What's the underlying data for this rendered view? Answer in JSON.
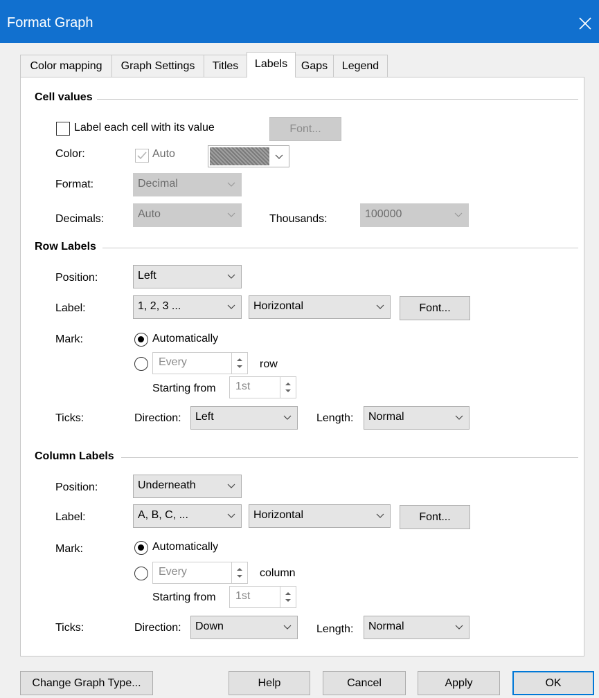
{
  "window": {
    "title": "Format Graph"
  },
  "tabs": [
    "Color mapping",
    "Graph Settings",
    "Titles",
    "Labels",
    "Gaps",
    "Legend"
  ],
  "cell_values": {
    "section_title": "Cell values",
    "label_each_cell": "Label each cell with its value",
    "font_button": "Font...",
    "color_label": "Color:",
    "auto_label": "Auto",
    "format_label": "Format:",
    "format_value": "Decimal",
    "decimals_label": "Decimals:",
    "decimals_value": "Auto",
    "thousands_label": "Thousands:",
    "thousands_value": "100000"
  },
  "row_labels": {
    "section_title": "Row Labels",
    "position_label": "Position:",
    "position_value": "Left",
    "label_label": "Label:",
    "label_value": "1, 2, 3 ...",
    "orientation_value": "Horizontal",
    "font_button": "Font...",
    "mark_label": "Mark:",
    "automatically": "Automatically",
    "every_value": "Every",
    "every_unit": "row",
    "starting_from": "Starting from",
    "starting_value": "1st",
    "ticks_label": "Ticks:",
    "direction_label": "Direction:",
    "direction_value": "Left",
    "length_label": "Length:",
    "length_value": "Normal"
  },
  "column_labels": {
    "section_title": "Column Labels",
    "position_label": "Position:",
    "position_value": "Underneath",
    "label_label": "Label:",
    "label_value": "A, B, C, ...",
    "orientation_value": "Horizontal",
    "font_button": "Font...",
    "mark_label": "Mark:",
    "automatically": "Automatically",
    "every_value": "Every",
    "every_unit": "column",
    "starting_from": "Starting from",
    "starting_value": "1st",
    "ticks_label": "Ticks:",
    "direction_label": "Direction:",
    "direction_value": "Down",
    "length_label": "Length:",
    "length_value": "Normal"
  },
  "footer": {
    "change_type": "Change Graph Type...",
    "help": "Help",
    "cancel": "Cancel",
    "apply": "Apply",
    "ok": "OK"
  },
  "colors": {
    "titlebar": "#1170cf",
    "focus": "#0078d7"
  }
}
